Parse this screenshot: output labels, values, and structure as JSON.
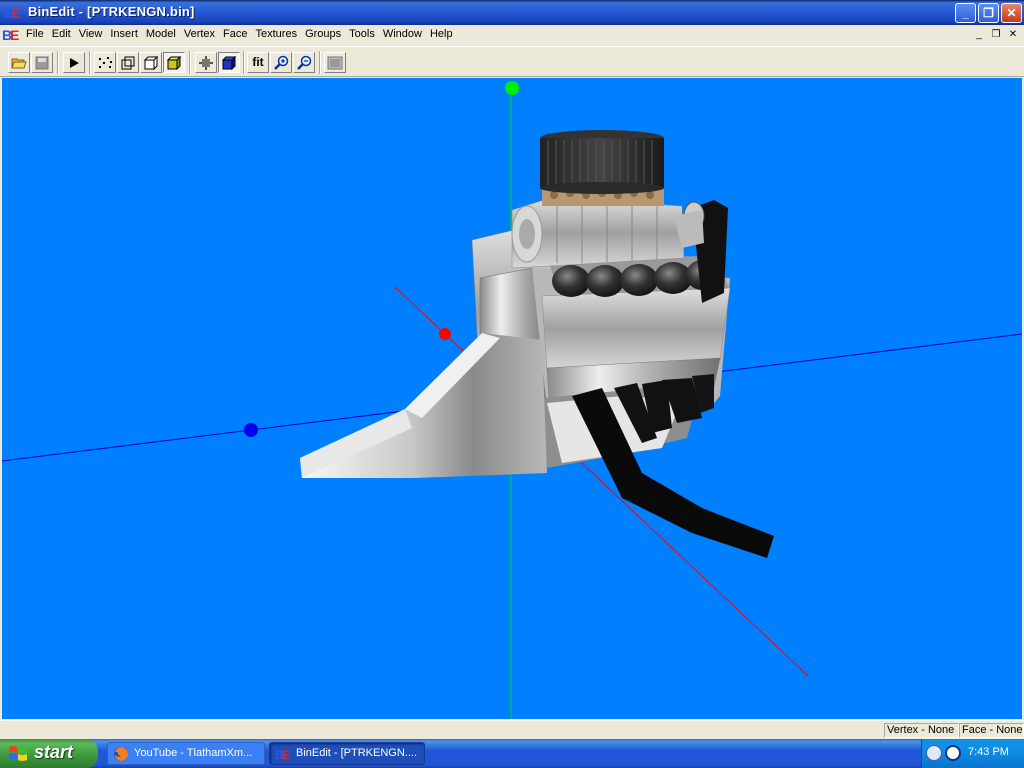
{
  "window": {
    "title": "BinEdit - [PTRKENGN.bin]",
    "controls": [
      "minimize",
      "restore",
      "close"
    ]
  },
  "menu": {
    "items": [
      "File",
      "Edit",
      "View",
      "Insert",
      "Model",
      "Vertex",
      "Face",
      "Textures",
      "Groups",
      "Tools",
      "Window",
      "Help"
    ]
  },
  "toolbar": {
    "fit_label": "fit",
    "buttons": [
      "open-icon",
      "save-icon",
      "play-icon",
      "vertices-icon",
      "wireframe-icon",
      "flat-shade-icon",
      "textured-icon",
      "point-mode-icon",
      "solid-mode-icon",
      "fit",
      "zoom-in-icon",
      "zoom-out-icon",
      "screenshot-icon"
    ]
  },
  "viewport": {
    "background": "#0080ff",
    "axis_colors": {
      "x": "#0000cc",
      "y": "#00dd00",
      "z": "#ff0000"
    }
  },
  "status": {
    "vertex": "Vertex - None",
    "face": "Face - None"
  },
  "taskbar": {
    "start_label": "start",
    "tasks": [
      {
        "label": "YouTube - TlathamXm...",
        "icon": "firefox-icon",
        "active": false
      },
      {
        "label": "BinEdit - [PTRKENGN....",
        "icon": "binedit-icon",
        "active": true
      }
    ],
    "clock": "7:43 PM"
  }
}
